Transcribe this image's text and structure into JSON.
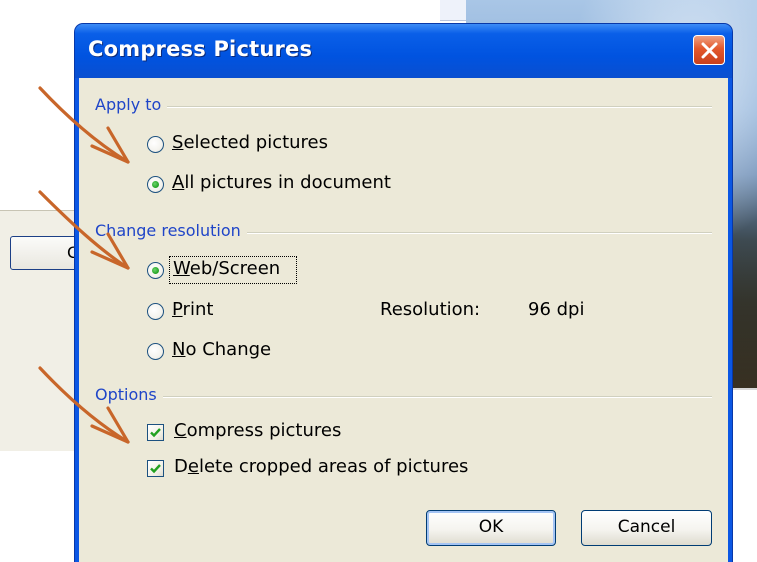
{
  "background": {
    "button_label": "C"
  },
  "dialog": {
    "title": "Compress Pictures",
    "close_icon": "close-x-icon",
    "apply_to": {
      "label": "Apply to",
      "options": [
        {
          "label": "Selected pictures",
          "mnemonic": "S",
          "rest": "elected pictures",
          "checked": false
        },
        {
          "label": "All pictures in document",
          "mnemonic": "A",
          "rest": "ll pictures in document",
          "checked": true
        }
      ]
    },
    "change_resolution": {
      "label": "Change resolution",
      "options": [
        {
          "label": "Web/Screen",
          "mnemonic": "W",
          "rest": "eb/Screen",
          "checked": true
        },
        {
          "label": "Print",
          "mnemonic": "P",
          "rest": "rint",
          "checked": false
        },
        {
          "label": "No Change",
          "mnemonic": "N",
          "rest": "o Change",
          "checked": false
        }
      ],
      "resolution_label": "Resolution:",
      "resolution_value": "96 dpi"
    },
    "options": {
      "label": "Options",
      "checkboxes": [
        {
          "label": "Compress pictures",
          "mnemonic": "C",
          "rest": "ompress pictures",
          "pre": "",
          "checked": true
        },
        {
          "label": "Delete cropped areas of pictures",
          "pre": "D",
          "mnemonic": "e",
          "rest": "lete cropped areas of pictures",
          "checked": true
        }
      ]
    },
    "buttons": {
      "ok": "OK",
      "cancel": "Cancel"
    }
  },
  "colors": {
    "title_bar": "#0053e0",
    "client_bg": "#ece9d8",
    "group_label": "#1f45c8",
    "annotation_arrow": "#c8662a"
  }
}
